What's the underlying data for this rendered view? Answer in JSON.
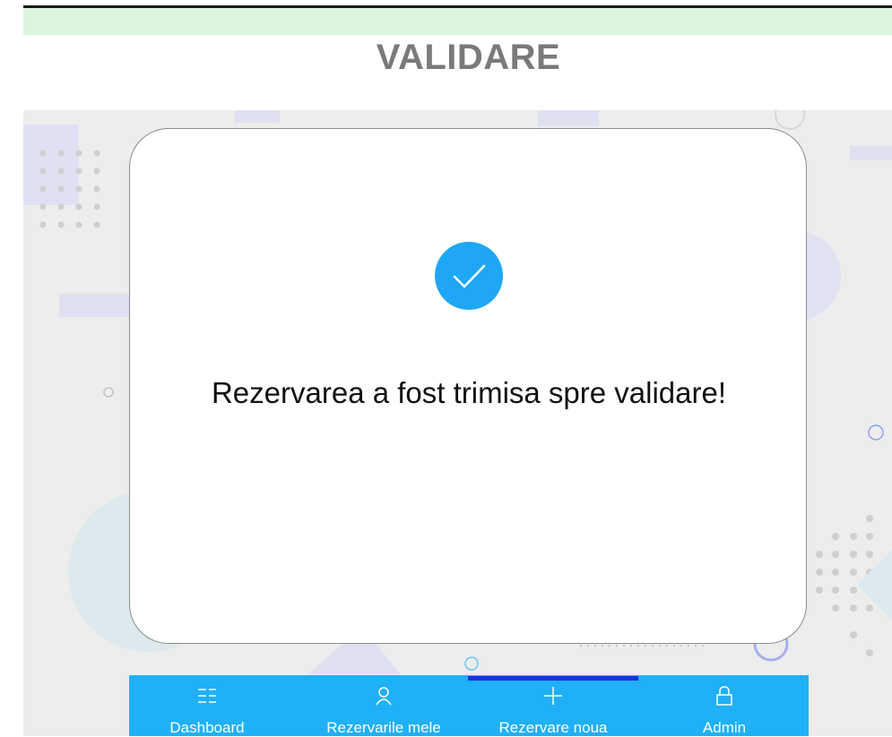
{
  "page": {
    "title": "VALIDARE"
  },
  "modal": {
    "message": "Rezervarea a fost trimisa spre validare!",
    "icon": "check-circle-icon",
    "icon_color": "#1ea7f5"
  },
  "nav": {
    "background": "#1fb0f7",
    "active_indicator_color": "#1f2ce0",
    "items": [
      {
        "label": "Dashboard",
        "icon": "list-icon"
      },
      {
        "label": "Rezervarile mele",
        "icon": "user-icon"
      },
      {
        "label": "Rezervare noua",
        "icon": "plus-icon",
        "active": true
      },
      {
        "label": "Admin",
        "icon": "lock-icon"
      }
    ]
  }
}
